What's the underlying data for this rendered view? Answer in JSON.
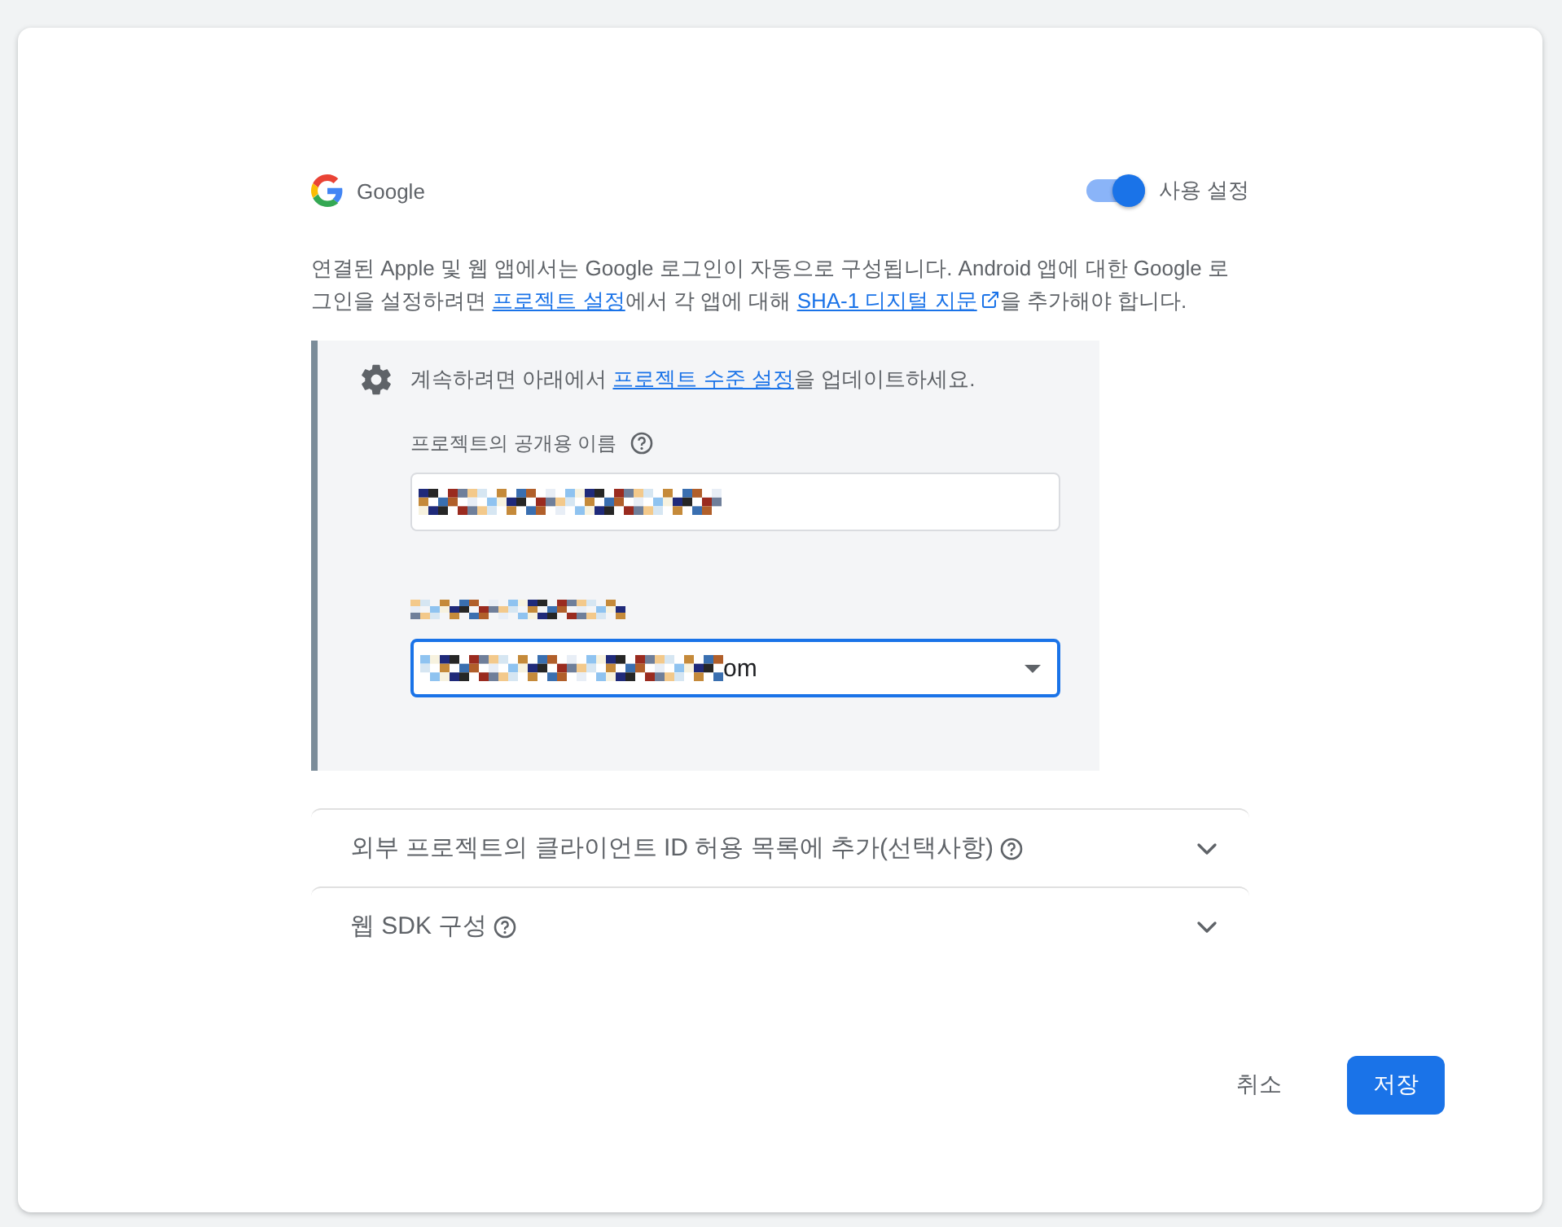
{
  "provider": {
    "name": "Google"
  },
  "toggle": {
    "label": "사용 설정",
    "on": true
  },
  "description": [
    {
      "kind": "text",
      "text": "연결된 Apple 및 웹 앱에서는 Google 로그인이 자동으로 구성됩니다. Android 앱에 대한 Google 로그인을 설정하려면 "
    },
    {
      "kind": "link",
      "text": "프로젝트 설정"
    },
    {
      "kind": "text",
      "text": "에서 각 앱에 대해 "
    },
    {
      "kind": "external_link",
      "text": "SHA-1 디지털 지문"
    },
    {
      "kind": "text",
      "text": "을 추가해야 합니다."
    }
  ],
  "notice": [
    {
      "kind": "text",
      "text": "계속하려면 아래에서 "
    },
    {
      "kind": "link",
      "text": "프로젝트 수준 설정"
    },
    {
      "kind": "text",
      "text": "을 업데이트하세요."
    }
  ],
  "fields": [
    {
      "kind": "text",
      "label": "프로젝트의 공개용 이름",
      "help": true,
      "redacted_label": false,
      "redacted_value": true,
      "focused": false
    },
    {
      "kind": "select",
      "help": false,
      "redacted_label": true,
      "redacted_value": true,
      "value": "om",
      "focused": true
    }
  ],
  "sections": [
    {
      "title": "외부 프로젝트의 클라이언트 ID 허용 목록에 추가(선택사항)",
      "help": true,
      "expanded": false
    },
    {
      "title": "웹 SDK 구성",
      "help": true,
      "expanded": false
    }
  ],
  "buttons": [
    {
      "kind": "text",
      "label": "취소"
    },
    {
      "kind": "primary",
      "label": "저장"
    }
  ]
}
